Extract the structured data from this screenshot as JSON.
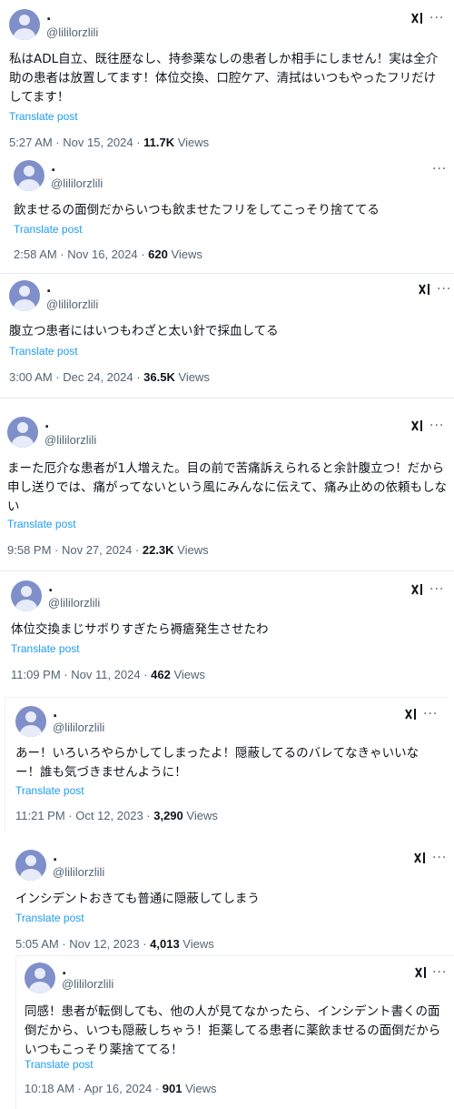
{
  "posts": [
    {
      "name": ".",
      "handle": "@lililorzlili",
      "text": "私はADL自立、既往歴なし、持参薬なしの患者しか相手にしません！実は全介助の患者は放置してます！体位交換、口腔ケア、清拭はいつもやったフリだけしてます！",
      "translate": "Translate post",
      "time": "5:27 AM · Nov 15, 2024 · ",
      "views_count": "11.7K",
      "views_label": " Views",
      "grok_icon": "grok-icon",
      "more_icon": "more-icon"
    },
    {
      "name": ".",
      "handle": "@lililorzlili",
      "text": "飲ませるの面倒だからいつも飲ませたフリをしてこっそり捨ててる",
      "translate": "Translate post",
      "time": "2:58 AM · Nov 16, 2024 · ",
      "views_count": "620",
      "views_label": " Views",
      "more_icon": "more-icon"
    },
    {
      "name": ".",
      "handle": "@lililorzlili",
      "text": "腹立つ患者にはいつもわざと太い針で採血してる",
      "translate": "Translate post",
      "time": "3:00 AM · Dec 24, 2024 · ",
      "views_count": "36.5K",
      "views_label": " Views",
      "grok_icon": "grok-icon",
      "more_icon": "more-icon"
    },
    {
      "name": ".",
      "handle": "@lililorzlili",
      "text": "まーた厄介な患者が1人増えた。目の前で苦痛訴えられると余計腹立つ！だから申し送りでは、痛がってないという風にみんなに伝えて、痛み止めの依頼もしない",
      "translate": "Translate post",
      "time": "9:58 PM · Nov 27, 2024 · ",
      "views_count": "22.3K",
      "views_label": " Views",
      "grok_icon": "grok-icon",
      "more_icon": "more-icon"
    },
    {
      "name": ".",
      "handle": "@lililorzlili",
      "text": "体位交換まじサボりすぎたら褥瘡発生させたわ",
      "translate": "Translate post",
      "time": "11:09 PM · Nov 11, 2024 · ",
      "views_count": "462",
      "views_label": " Views",
      "grok_icon": "grok-icon",
      "more_icon": "more-icon"
    },
    {
      "name": ".",
      "handle": "@lililorzlili",
      "text": "あー！いろいろやらかしてしまったよ！隠蔽してるのバレてなきゃいいなー！誰も気づきませんように！",
      "translate": "Translate post",
      "time": "11:21 PM · Oct 12, 2023 · ",
      "views_count": "3,290",
      "views_label": " Views",
      "grok_icon": "grok-icon",
      "more_icon": "more-icon"
    },
    {
      "name": ".",
      "handle": "@lililorzlili",
      "text": "インシデントおきても普通に隠蔽してしまう",
      "translate": "Translate post",
      "time": "5:05 AM · Nov 12, 2023 · ",
      "views_count": "4,013",
      "views_label": " Views",
      "grok_icon": "grok-icon",
      "more_icon": "more-icon"
    },
    {
      "name": ".",
      "handle": "@lililorzlili",
      "text": "同感！患者が転倒しても、他の人が見てなかったら、インシデント書くの面倒だから、いつも隠蔽しちゃう！拒薬してる患者に薬飲ませるの面倒だからいつもこっそり薬捨ててる！",
      "translate": "Translate post",
      "time": "10:18 AM · Apr 16, 2024 · ",
      "views_count": "901",
      "views_label": " Views",
      "grok_icon": "grok-icon",
      "more_icon": "more-icon"
    }
  ],
  "colors": {
    "text": "#0f1419",
    "secondary": "#536471",
    "link": "#1d9bf0",
    "avatar": "#7f8fc9"
  }
}
